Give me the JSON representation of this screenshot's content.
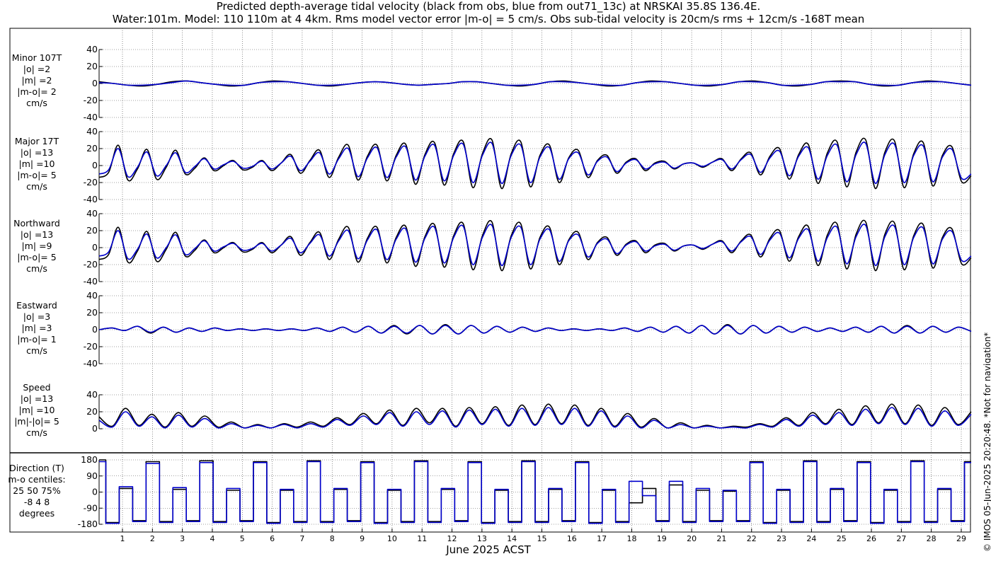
{
  "title": {
    "line1": "Predicted depth-average tidal velocity (black from obs, blue from out71_13c) at NRSKAI 35.8S 136.4E.",
    "line2": "Water:101m. Model: 110 110m at 4 4km. Rms model vector error |m-o| = 5 cm/s. Obs sub-tidal velocity is 20cm/s rms + 12cm/s -168T mean"
  },
  "copyright": "© IMOS 05-Jun-2025 20:20:48. *Not for navigation*",
  "colors": {
    "obs": "#000000",
    "model": "#0000cc",
    "grid": "#444444"
  },
  "chart_data": [
    {
      "type": "line",
      "name": "minor",
      "label_lines": [
        "Minor 107T",
        "|o| =2",
        "|m| =2",
        "|m-o|= 2",
        "cm/s"
      ],
      "ylim": [
        -40,
        40
      ],
      "yticks": [
        "-40",
        "-20",
        "0",
        "20",
        "40"
      ],
      "series": [
        {
          "name": "obs",
          "values": [
            2,
            0,
            -2,
            -3,
            -1,
            2,
            3,
            1,
            -1,
            -3,
            -2,
            1,
            3,
            2,
            0,
            -2,
            -3,
            -1,
            1,
            2,
            1,
            -1,
            -2,
            -1,
            0,
            2,
            2,
            0,
            -2,
            -3,
            -1,
            2,
            3,
            1,
            -1,
            -3,
            -2,
            1,
            3,
            2,
            0,
            -2,
            -3,
            -1,
            2,
            3,
            1,
            -2,
            -3,
            -1,
            2,
            3,
            2,
            -1,
            -3,
            -2,
            1,
            3,
            2,
            0,
            -2
          ]
        },
        {
          "name": "model",
          "values": [
            1,
            0,
            -2,
            -2,
            -1,
            1,
            3,
            1,
            -1,
            -2,
            -2,
            1,
            2,
            2,
            0,
            -2,
            -2,
            -1,
            1,
            2,
            1,
            -1,
            -2,
            -1,
            0,
            2,
            2,
            0,
            -2,
            -2,
            -1,
            2,
            2,
            1,
            -1,
            -2,
            -2,
            1,
            2,
            2,
            0,
            -2,
            -2,
            -1,
            2,
            2,
            1,
            -2,
            -2,
            -1,
            2,
            2,
            2,
            -1,
            -2,
            -2,
            1,
            2,
            2,
            0,
            -2
          ]
        }
      ]
    },
    {
      "type": "line",
      "name": "major",
      "label_lines": [
        "Major 17T",
        "|o| =13",
        "|m| =10",
        "|m-o|= 5",
        "cm/s"
      ],
      "ylim": [
        -40,
        40
      ],
      "yticks": [
        "-40",
        "-20",
        "0",
        "20",
        "40"
      ],
      "series": [
        {
          "name": "obs",
          "values": [
            -14,
            -8,
            24,
            -17,
            -4,
            19,
            -16,
            -2,
            18,
            -10,
            -3,
            9,
            -6,
            0,
            6,
            -5,
            -2,
            6,
            -6,
            3,
            13,
            -9,
            6,
            18,
            -14,
            10,
            24,
            -17,
            11,
            24,
            -18,
            12,
            25,
            -22,
            13,
            27,
            -23,
            14,
            28,
            -26,
            14,
            30,
            -27,
            14,
            28,
            -25,
            12,
            24,
            -20,
            9,
            18,
            -14,
            6,
            12,
            -9,
            4,
            8,
            -6,
            3,
            5,
            -4,
            2,
            3,
            -2,
            4,
            8,
            -6,
            8,
            15,
            -11,
            11,
            20,
            -16,
            13,
            25,
            -21,
            15,
            28,
            -25,
            16,
            30,
            -27,
            16,
            29,
            -26,
            14,
            27,
            -24,
            12,
            22,
            -19,
            -12
          ]
        },
        {
          "name": "model",
          "values": [
            -10,
            -5,
            20,
            -13,
            -2,
            16,
            -12,
            0,
            15,
            -8,
            -1,
            8,
            -4,
            1,
            5,
            -3,
            -1,
            5,
            -4,
            3,
            11,
            -6,
            5,
            15,
            -10,
            8,
            20,
            -13,
            9,
            21,
            -14,
            10,
            22,
            -17,
            11,
            24,
            -18,
            12,
            25,
            -20,
            12,
            26,
            -21,
            12,
            24,
            -20,
            10,
            21,
            -16,
            8,
            15,
            -11,
            5,
            10,
            -7,
            3,
            7,
            -4,
            2,
            4,
            -3,
            2,
            3,
            -1,
            4,
            7,
            -4,
            7,
            13,
            -8,
            9,
            17,
            -12,
            11,
            21,
            -16,
            12,
            24,
            -19,
            13,
            26,
            -21,
            13,
            25,
            -20,
            12,
            23,
            -19,
            10,
            19,
            -15,
            -10
          ]
        }
      ]
    },
    {
      "type": "line",
      "name": "northward",
      "label_lines": [
        "Northward",
        "|o| =13",
        "|m| =9",
        "|m-o|= 5",
        "cm/s"
      ],
      "ylim": [
        -40,
        40
      ],
      "yticks": [
        "-40",
        "-20",
        "0",
        "20",
        "40"
      ],
      "series": [
        {
          "name": "obs",
          "values": [
            -14,
            -8,
            24,
            -17,
            -4,
            19,
            -16,
            -2,
            18,
            -10,
            -3,
            9,
            -6,
            0,
            6,
            -5,
            -2,
            6,
            -6,
            3,
            13,
            -9,
            6,
            18,
            -14,
            10,
            24,
            -17,
            11,
            24,
            -18,
            12,
            25,
            -22,
            13,
            27,
            -23,
            14,
            28,
            -26,
            14,
            30,
            -27,
            14,
            28,
            -25,
            12,
            24,
            -20,
            9,
            18,
            -14,
            6,
            12,
            -9,
            4,
            8,
            -6,
            3,
            5,
            -4,
            2,
            3,
            -2,
            4,
            8,
            -6,
            8,
            15,
            -11,
            11,
            20,
            -16,
            13,
            25,
            -21,
            15,
            28,
            -25,
            16,
            30,
            -27,
            16,
            29,
            -26,
            14,
            27,
            -24,
            12,
            22,
            -19,
            -12
          ]
        },
        {
          "name": "model",
          "values": [
            -10,
            -5,
            20,
            -13,
            -2,
            16,
            -12,
            0,
            15,
            -8,
            -1,
            8,
            -4,
            1,
            5,
            -3,
            -1,
            5,
            -4,
            3,
            11,
            -6,
            5,
            15,
            -10,
            8,
            20,
            -13,
            9,
            21,
            -14,
            10,
            22,
            -17,
            11,
            24,
            -18,
            12,
            25,
            -20,
            12,
            26,
            -21,
            12,
            24,
            -20,
            10,
            21,
            -16,
            8,
            15,
            -11,
            5,
            10,
            -7,
            3,
            7,
            -4,
            2,
            4,
            -3,
            2,
            3,
            -1,
            4,
            7,
            -4,
            7,
            13,
            -8,
            9,
            17,
            -12,
            11,
            21,
            -16,
            12,
            24,
            -19,
            13,
            26,
            -21,
            13,
            25,
            -20,
            12,
            23,
            -19,
            10,
            19,
            -15,
            -10
          ]
        }
      ]
    },
    {
      "type": "line",
      "name": "eastward",
      "label_lines": [
        "Eastward",
        "|o| =3",
        "|m| =3",
        "|m-o|= 1",
        "cm/s"
      ],
      "ylim": [
        -40,
        40
      ],
      "yticks": [
        "-40",
        "-20",
        "0",
        "20",
        "40"
      ],
      "series": [
        {
          "name": "obs",
          "values": [
            0,
            2,
            -1,
            4,
            -4,
            3,
            -3,
            2,
            -2,
            2,
            -1,
            1,
            -1,
            1,
            -1,
            1,
            -1,
            2,
            -2,
            3,
            -3,
            4,
            -4,
            5,
            -5,
            5,
            -5,
            6,
            -5,
            5,
            -4,
            4,
            -3,
            3,
            -2,
            2,
            -1,
            1,
            -1,
            1,
            -1,
            2,
            -2,
            3,
            -3,
            4,
            -4,
            5,
            -5,
            6,
            -5,
            5,
            -4,
            4,
            -3,
            3,
            -2,
            2,
            -2,
            3,
            -3,
            4,
            -4,
            5,
            -4,
            4,
            -3,
            3,
            -2
          ]
        },
        {
          "name": "model",
          "values": [
            0,
            2,
            -1,
            4,
            -3,
            3,
            -3,
            2,
            -2,
            2,
            -1,
            1,
            -1,
            1,
            -1,
            1,
            -1,
            2,
            -2,
            3,
            -3,
            4,
            -4,
            4,
            -4,
            5,
            -5,
            5,
            -5,
            5,
            -4,
            4,
            -3,
            3,
            -2,
            2,
            -1,
            1,
            -1,
            1,
            -1,
            2,
            -2,
            3,
            -3,
            4,
            -4,
            5,
            -5,
            5,
            -5,
            5,
            -4,
            4,
            -3,
            3,
            -2,
            2,
            -2,
            3,
            -3,
            4,
            -4,
            4,
            -4,
            4,
            -3,
            3,
            -2
          ]
        }
      ]
    },
    {
      "type": "line",
      "name": "speed",
      "label_lines": [
        "Speed",
        "|o| =13",
        "|m| =10",
        "|m|-|o|= 5",
        "cm/s"
      ],
      "ylim": [
        0,
        40
      ],
      "yticks": [
        "0",
        "20",
        "40"
      ],
      "series": [
        {
          "name": "obs",
          "values": [
            14,
            3,
            24,
            4,
            17,
            2,
            19,
            3,
            15,
            2,
            8,
            1,
            5,
            1,
            6,
            2,
            8,
            3,
            13,
            5,
            18,
            6,
            22,
            4,
            24,
            7,
            24,
            3,
            25,
            6,
            26,
            4,
            28,
            5,
            29,
            6,
            28,
            4,
            24,
            3,
            18,
            2,
            12,
            1,
            7,
            1,
            4,
            1,
            3,
            2,
            6,
            3,
            13,
            4,
            19,
            6,
            23,
            5,
            27,
            7,
            29,
            6,
            28,
            4,
            25,
            5,
            20
          ]
        },
        {
          "name": "model",
          "values": [
            10,
            2,
            20,
            3,
            14,
            1,
            16,
            2,
            12,
            1,
            6,
            1,
            4,
            1,
            5,
            1,
            6,
            2,
            11,
            4,
            15,
            5,
            19,
            3,
            20,
            5,
            21,
            2,
            22,
            5,
            23,
            3,
            24,
            4,
            25,
            5,
            24,
            3,
            21,
            2,
            15,
            1,
            10,
            1,
            5,
            1,
            3,
            1,
            2,
            1,
            5,
            2,
            11,
            3,
            16,
            5,
            19,
            4,
            23,
            6,
            25,
            5,
            24,
            3,
            21,
            4,
            17
          ]
        }
      ]
    },
    {
      "type": "line",
      "name": "direction",
      "label_lines": [
        "Direction (T)",
        "m-o centiles:",
        "25  50  75%",
        "-8  4  8",
        "degrees"
      ],
      "ylim": [
        -180,
        180
      ],
      "yticks": [
        "-180",
        "-90",
        "0",
        "90",
        "180"
      ],
      "x": [
        "1",
        "2",
        "3",
        "4",
        "5",
        "6",
        "7",
        "8",
        "9",
        "10",
        "11",
        "12",
        "13",
        "14",
        "15",
        "16",
        "17",
        "18",
        "19",
        "20",
        "21",
        "22",
        "23",
        "24",
        "25",
        "26",
        "27",
        "28",
        "29"
      ],
      "xlabel": "June 2025 ACST",
      "series": [
        {
          "name": "obs",
          "values": [
            180,
            -170,
            20,
            -160,
            170,
            -165,
            15,
            -160,
            175,
            -165,
            10,
            -160,
            170,
            -170,
            10,
            -165,
            175,
            -165,
            15,
            -160,
            170,
            -170,
            10,
            -165,
            175,
            -165,
            15,
            -160,
            170,
            -170,
            10,
            -165,
            175,
            -165,
            15,
            -160,
            170,
            -170,
            10,
            -165,
            -60,
            20,
            -160,
            40,
            -165,
            10,
            -160,
            5,
            -160,
            170,
            -170,
            10,
            -165,
            175,
            -165,
            15,
            -160,
            170,
            -170,
            10,
            -165,
            175,
            -165,
            15,
            -160,
            170
          ]
        },
        {
          "name": "model",
          "values": [
            170,
            -175,
            30,
            -165,
            160,
            -170,
            25,
            -165,
            165,
            -170,
            20,
            -165,
            165,
            -175,
            15,
            -170,
            170,
            -170,
            20,
            -165,
            165,
            -175,
            15,
            -170,
            170,
            -170,
            20,
            -165,
            165,
            -175,
            15,
            -170,
            170,
            -170,
            20,
            -165,
            165,
            -175,
            15,
            -170,
            60,
            -20,
            -165,
            60,
            -170,
            20,
            -165,
            10,
            -165,
            165,
            -175,
            15,
            -170,
            170,
            -170,
            20,
            -165,
            165,
            -175,
            15,
            -170,
            170,
            -170,
            20,
            -165,
            165
          ]
        }
      ]
    }
  ]
}
